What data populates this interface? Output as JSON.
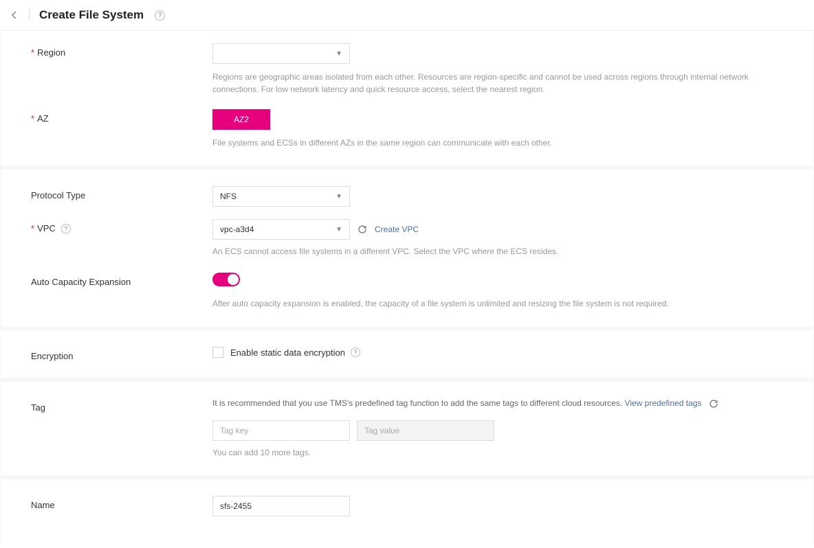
{
  "header": {
    "title": "Create File System"
  },
  "region": {
    "label": "Region",
    "value": "",
    "help": "Regions are geographic areas isolated from each other. Resources are region-specific and cannot be used across regions through internal network connections. For low network latency and quick resource access, select the nearest region."
  },
  "az": {
    "label": "AZ",
    "options": [
      "AZ2"
    ],
    "help": "File systems and ECSs in different AZs in the same region can communicate with each other."
  },
  "protocol": {
    "label": "Protocol Type",
    "value": "NFS"
  },
  "vpc": {
    "label": "VPC",
    "value": "vpc-a3d4",
    "create_link": "Create VPC",
    "help": "An ECS cannot access file systems in a different VPC. Select the VPC where the ECS resides."
  },
  "auto_capacity": {
    "label": "Auto Capacity Expansion",
    "enabled": true,
    "help": "After auto capacity expansion is enabled, the capacity of a file system is unlimited and resizing the file system is not required."
  },
  "encryption": {
    "label": "Encryption",
    "checkbox_label": "Enable static data encryption"
  },
  "tag": {
    "label": "Tag",
    "help_prefix": "It is recommended that you use TMS's predefined tag function to add the same tags to different cloud resources. ",
    "link": "View predefined tags",
    "key_placeholder": "Tag key",
    "value_placeholder": "Tag value",
    "remaining": "You can add 10 more tags."
  },
  "name": {
    "label": "Name",
    "value": "sfs-2455"
  }
}
